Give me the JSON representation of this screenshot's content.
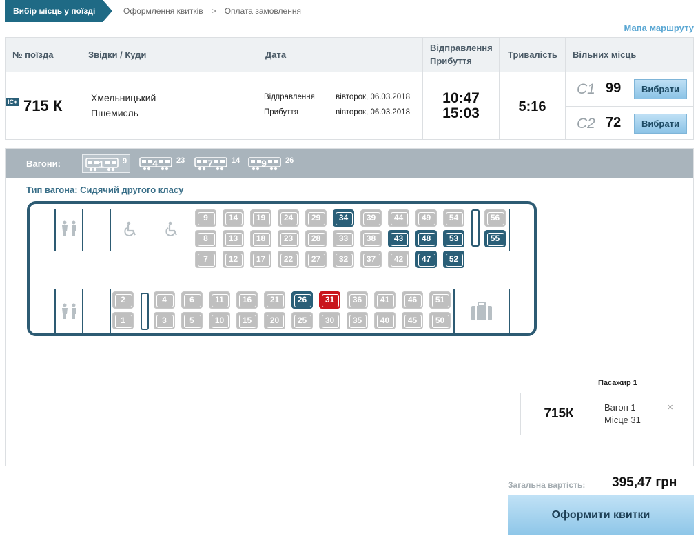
{
  "steps": {
    "active": "Вибір місць у поїзді",
    "second": "Оформлення квитків",
    "third": "Оплата замовлення",
    "separator": ">"
  },
  "route_map_link": "Мапа маршруту",
  "table": {
    "headers": {
      "train_no": "№ поїзда",
      "from_to": "Звідки / Куди",
      "date": "Дата",
      "dep_arr_line1": "Відправлення",
      "dep_arr_line2": "Прибуття",
      "duration": "Тривалість",
      "free_seats": "Вільних місць"
    },
    "row": {
      "badge": "IC+",
      "train_number": "715 К",
      "from": "Хмельницький",
      "to": "Пшемисль",
      "departure_label": "Відправлення",
      "departure_date": "вівторок, 06.03.2018",
      "arrival_label": "Прибуття",
      "arrival_date": "вівторок, 06.03.2018",
      "departure_time": "10:47",
      "arrival_time": "15:03",
      "duration": "5:16",
      "classes": [
        {
          "name": "С1",
          "free": "99",
          "button": "Вибрати"
        },
        {
          "name": "С2",
          "free": "72",
          "button": "Вибрати"
        }
      ]
    }
  },
  "wagons": {
    "label": "Вагони:",
    "list": [
      {
        "number": "1",
        "free": "9",
        "selected": true
      },
      {
        "number": "4",
        "free": "23",
        "selected": false
      },
      {
        "number": "7",
        "free": "14",
        "selected": false
      },
      {
        "number": "9",
        "free": "26",
        "selected": false
      }
    ],
    "type": "Тип вагона: Сидячий другого класу"
  },
  "seats": {
    "top_rows": [
      [
        "9",
        "14",
        "19",
        "24",
        "29",
        "34",
        "39",
        "44",
        "49",
        "54",
        "56"
      ],
      [
        "8",
        "13",
        "18",
        "23",
        "28",
        "33",
        "38",
        "43",
        "48",
        "53",
        "55"
      ],
      [
        "7",
        "12",
        "17",
        "22",
        "27",
        "32",
        "37",
        "42",
        "47",
        "52"
      ]
    ],
    "bottom_rows": [
      [
        "2",
        "4",
        "6",
        "11",
        "16",
        "21",
        "26",
        "31",
        "36",
        "41",
        "46",
        "51"
      ],
      [
        "1",
        "3",
        "5",
        "10",
        "15",
        "20",
        "25",
        "30",
        "35",
        "40",
        "45",
        "50"
      ]
    ],
    "free": [
      "34",
      "43",
      "48",
      "53",
      "55",
      "47",
      "52",
      "26"
    ],
    "chosen": [
      "31"
    ]
  },
  "icons": {
    "wc": "wc-icon",
    "wheelchair": "wheelchair-icon",
    "luggage": "luggage-icon",
    "close": "close-icon"
  },
  "passenger": {
    "title": "Пасажир 1",
    "train": "715К",
    "wagon": "Вагон 1",
    "seat": "Місце 31",
    "close": "×"
  },
  "total": {
    "label": "Загальна вартість:",
    "value": "395,47 грн"
  },
  "order_button": "Оформити квитки",
  "colors": {
    "primary": "#1f6a85",
    "free_seat": "#2a5f78",
    "chosen_seat": "#c9161c",
    "taken_seat": "#bfbfbf"
  }
}
